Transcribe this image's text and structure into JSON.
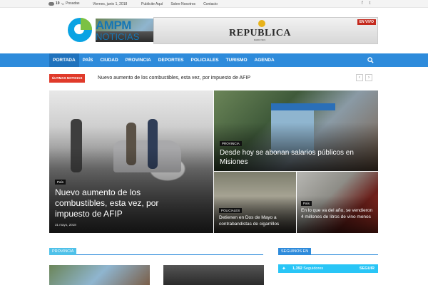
{
  "topbar": {
    "temperature": "19",
    "temp_unit": "°C",
    "weather_desc": "Posadas",
    "date": "Viernes, junio 1, 2018",
    "links": [
      "Publicite Aquí",
      "Sobre Nosotros",
      "Contacto"
    ],
    "social": [
      "f",
      "t"
    ]
  },
  "logo": {
    "line1": "AMPM",
    "line2": "NOTICIAS"
  },
  "banner": {
    "brand": "REPUBLICA",
    "sub": "RADIO 99.9",
    "live": "EN VIVO"
  },
  "nav": {
    "items": [
      "PORTADA",
      "PAÍS",
      "CIUDAD",
      "PROVINCIA",
      "DEPORTES",
      "POLICIALES",
      "TURISMO",
      "AGENDA"
    ]
  },
  "breaking": {
    "tag": "ÚLTIMAS NOTICIAS",
    "headline": "Nuevo aumento de los combustibles, esta vez, por impuesto de AFIP",
    "prev": "‹",
    "next": "›"
  },
  "featured": [
    {
      "category": "País",
      "title": "Nuevo aumento de los combustibles, esta vez, por impuesto de AFIP",
      "date": "31 mayo, 2018"
    },
    {
      "category": "PROVINCIA",
      "title": "Desde hoy se abonan salarios públicos en Misiones"
    },
    {
      "category": "POLICIALES",
      "title": "Detienen en Dos de Mayo a contrabandistas de cigarrillos"
    },
    {
      "category": "País",
      "title": "En lo que va del año, se vendieron 4 millones de litros de vino menos"
    }
  ],
  "sections": {
    "left": "PROVINCIA",
    "right": "SEGUINOS EN"
  },
  "twitter": {
    "count": "1,392",
    "label": "Seguidores",
    "follow": "SEGUIR"
  }
}
